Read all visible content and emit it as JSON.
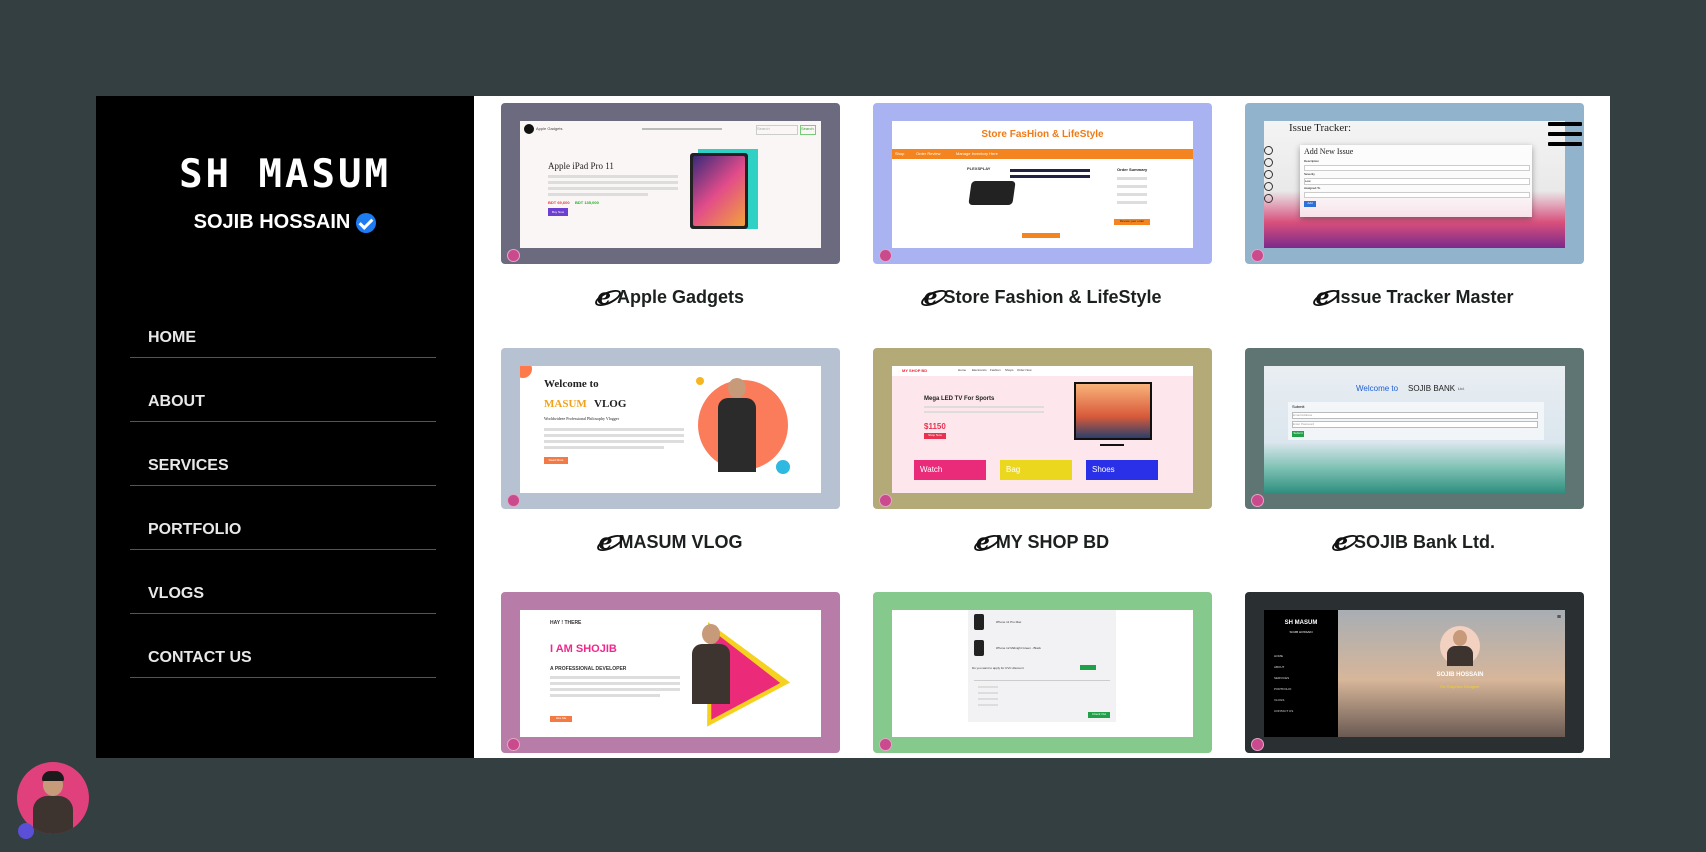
{
  "sidebar": {
    "brand": "SH MASUM",
    "subtitle": "SOJIB HOSSAIN",
    "nav": [
      {
        "label": "HOME"
      },
      {
        "label": "ABOUT"
      },
      {
        "label": "SERVICES"
      },
      {
        "label": "PORTFOLIO"
      },
      {
        "label": "VLOGS"
      },
      {
        "label": "CONTACT US"
      }
    ]
  },
  "portfolio": {
    "projects": [
      {
        "title": "Apple Gadgets",
        "frame_color": "#6c6a7e",
        "preview": {
          "brand": "Apple Gadgets",
          "heading": "Apple iPad Pro 11",
          "search_placeholder": "Search",
          "search_button": "Search",
          "price_old": "BDT 69,600",
          "price_new": "BDT 135,000",
          "cta": "Buy Now"
        }
      },
      {
        "title": "Store Fashion & LifeStyle",
        "frame_color": "#aab3f2",
        "preview": {
          "brand": "Store FasHion & LifeStyle",
          "nav": [
            "Shop",
            "Order Review",
            "Manage Inventory Here"
          ],
          "summary_title": "Order Summary",
          "badge": "PLEXSPLAY",
          "cta": "Review your order"
        }
      },
      {
        "title": "Issue Tracker Master",
        "frame_color": "#92b3cc",
        "preview": {
          "heading": "Issue Tracker:",
          "form_title": "Add New Issue",
          "labels": [
            "Description",
            "Severity",
            "Assigned To"
          ],
          "severity_value": "Low",
          "button": "Add"
        }
      },
      {
        "title": "MASUM VLOG",
        "frame_color": "#b6c2d1",
        "preview": {
          "welcome": "Welcome to",
          "brand_a": "MASUM",
          "brand_b": "VLOG",
          "tagline": "Worldwideee Professional Philosophy Vlogger",
          "cta": "Read More"
        }
      },
      {
        "title": "MY SHOP BD",
        "frame_color": "#b4aa78",
        "preview": {
          "brand": "MY SHOP BD",
          "nav": [
            "Home",
            "Electronics",
            "Fashion",
            "Shops",
            "Order Now"
          ],
          "headline": "Mega LED TV For Sports",
          "price": "$1150",
          "cta": "Shop Now",
          "categories": [
            "Watch",
            "Bag",
            "Shoes"
          ]
        }
      },
      {
        "title": "SOJIB Bank Ltd.",
        "frame_color": "#5f7573",
        "preview": {
          "welcome_a": "Welcome to",
          "welcome_b": "SOJIB BANK",
          "welcome_c": "Ltd.",
          "form_title": "Submit",
          "email_placeholder": "Email Address",
          "password_placeholder": "Enter Password",
          "button": "Submit"
        }
      },
      {
        "title": "",
        "frame_color": "#b77ca8",
        "preview": {
          "greeting": "HAY ! THERE",
          "headline": "I AM SHOJIB",
          "role": "A PROFESSIONAL DEVELOPER",
          "cta": "Hire Me"
        }
      },
      {
        "title": "",
        "frame_color": "#86c98c",
        "preview": {
          "items": [
            "iPhone 11 Pro Max",
            "iPhone 12 Midnight Green - Black"
          ],
          "check_label": "Do you want to apply for UVC discount",
          "button": "Check Out"
        }
      },
      {
        "title": "",
        "frame_color": "#2a3031",
        "preview": {
          "brand": "SH MASUM",
          "subtitle": "SOJIB HOSSAIN",
          "nav": [
            "HOME",
            "ABOUT",
            "SERVICES",
            "PORTFOLIO",
            "VLOGS",
            "CONTACT US"
          ],
          "name": "SOJIB HOSSAIN",
          "role": "I'm Graphics Designer"
        }
      }
    ]
  },
  "colors": {
    "page_bg": "#343f42",
    "sidebar_bg": "#000000",
    "content_bg": "#ffffff",
    "verified": "#1d7cf2",
    "avatar": "#e0417c"
  },
  "icons": {
    "verified": "verified-badge-icon",
    "project": "internet-explorer-icon",
    "menu": "hamburger-menu-icon"
  }
}
